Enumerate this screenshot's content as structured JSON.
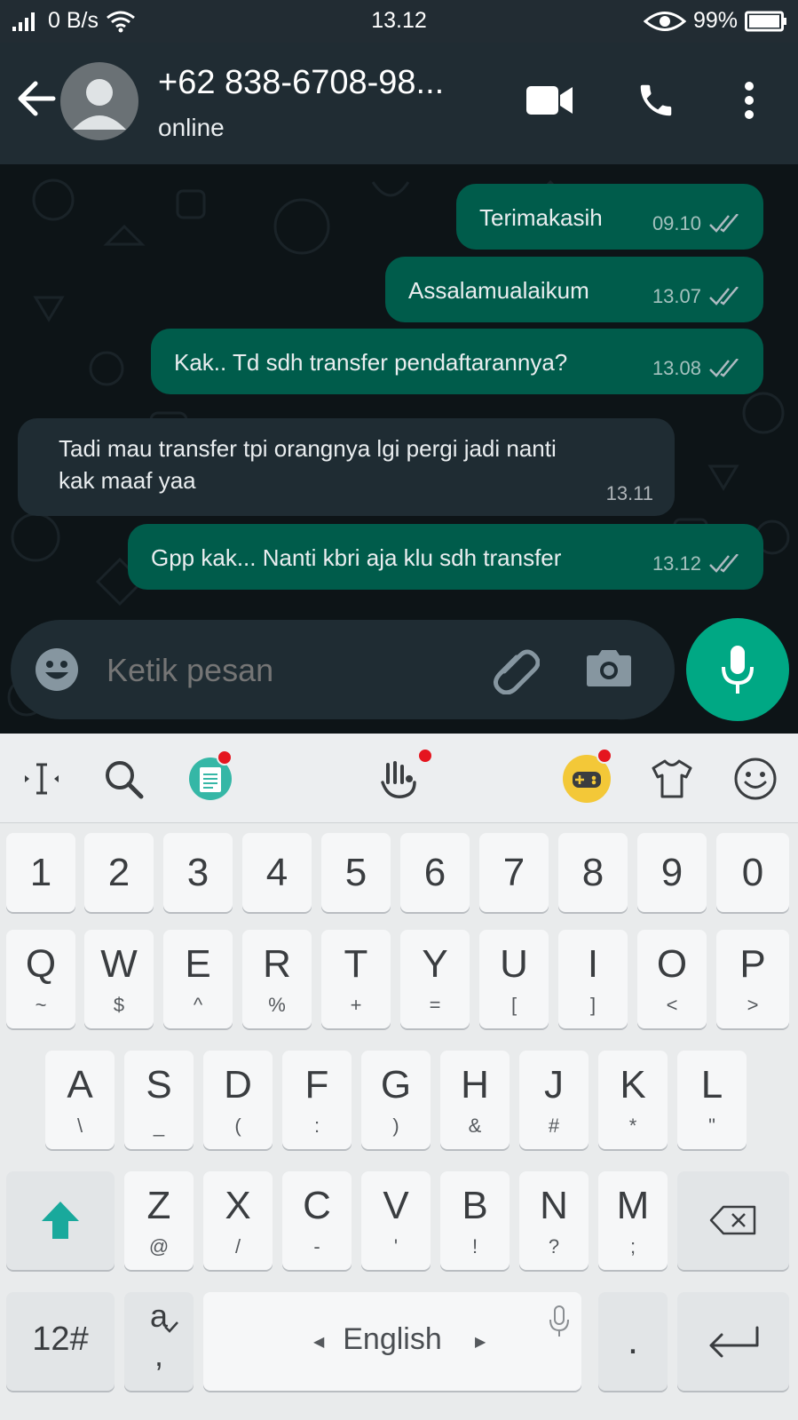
{
  "status_bar": {
    "net_speed": "0 B/s",
    "time": "13.12",
    "battery": "99%"
  },
  "header": {
    "contact_name": "+62 838-6708-98...",
    "contact_status": "online"
  },
  "messages": [
    {
      "direction": "out",
      "text": "Terimakasih",
      "time": "09.10"
    },
    {
      "direction": "out",
      "text": "Assalamualaikum",
      "time": "13.07"
    },
    {
      "direction": "out",
      "text": "Kak.. Td sdh transfer pendaftarannya?",
      "time": "13.08"
    },
    {
      "direction": "in",
      "text_lines": [
        "Tadi mau transfer tpi orangnya lgi pergi jadi nanti",
        "kak maaf yaa"
      ],
      "time": "13.11"
    },
    {
      "direction": "out",
      "text": "Gpp kak... Nanti kbri aja klu sdh transfer",
      "time": "13.12"
    }
  ],
  "composer": {
    "placeholder": "Ketik pesan"
  },
  "keyboard": {
    "number_row": [
      "1",
      "2",
      "3",
      "4",
      "5",
      "6",
      "7",
      "8",
      "9",
      "0"
    ],
    "row1": [
      {
        "main": "Q",
        "sub": "~"
      },
      {
        "main": "W",
        "sub": "$"
      },
      {
        "main": "E",
        "sub": "^"
      },
      {
        "main": "R",
        "sub": "%"
      },
      {
        "main": "T",
        "sub": "+"
      },
      {
        "main": "Y",
        "sub": "="
      },
      {
        "main": "U",
        "sub": "["
      },
      {
        "main": "I",
        "sub": "]"
      },
      {
        "main": "O",
        "sub": "<"
      },
      {
        "main": "P",
        "sub": ">"
      }
    ],
    "row2": [
      {
        "main": "A",
        "sub": "\\"
      },
      {
        "main": "S",
        "sub": "_"
      },
      {
        "main": "D",
        "sub": "("
      },
      {
        "main": "F",
        "sub": ":"
      },
      {
        "main": "G",
        "sub": ")"
      },
      {
        "main": "H",
        "sub": "&"
      },
      {
        "main": "J",
        "sub": "#"
      },
      {
        "main": "K",
        "sub": "*"
      },
      {
        "main": "L",
        "sub": "\""
      }
    ],
    "row3": [
      {
        "main": "Z",
        "sub": "@"
      },
      {
        "main": "X",
        "sub": "/"
      },
      {
        "main": "C",
        "sub": "-"
      },
      {
        "main": "V",
        "sub": "'"
      },
      {
        "main": "B",
        "sub": "!"
      },
      {
        "main": "N",
        "sub": "?"
      },
      {
        "main": "M",
        "sub": ";"
      }
    ],
    "symbols_label": "12#",
    "lang_key_top": "a",
    "lang_key_bottom": ",",
    "space_label": "English",
    "period_label": "."
  },
  "colors": {
    "header_bg": "#202c33",
    "outgoing_bubble": "#005c4b",
    "incoming_bubble": "#1f2c33",
    "accent": "#00a884",
    "shift_teal": "#19a99c"
  }
}
